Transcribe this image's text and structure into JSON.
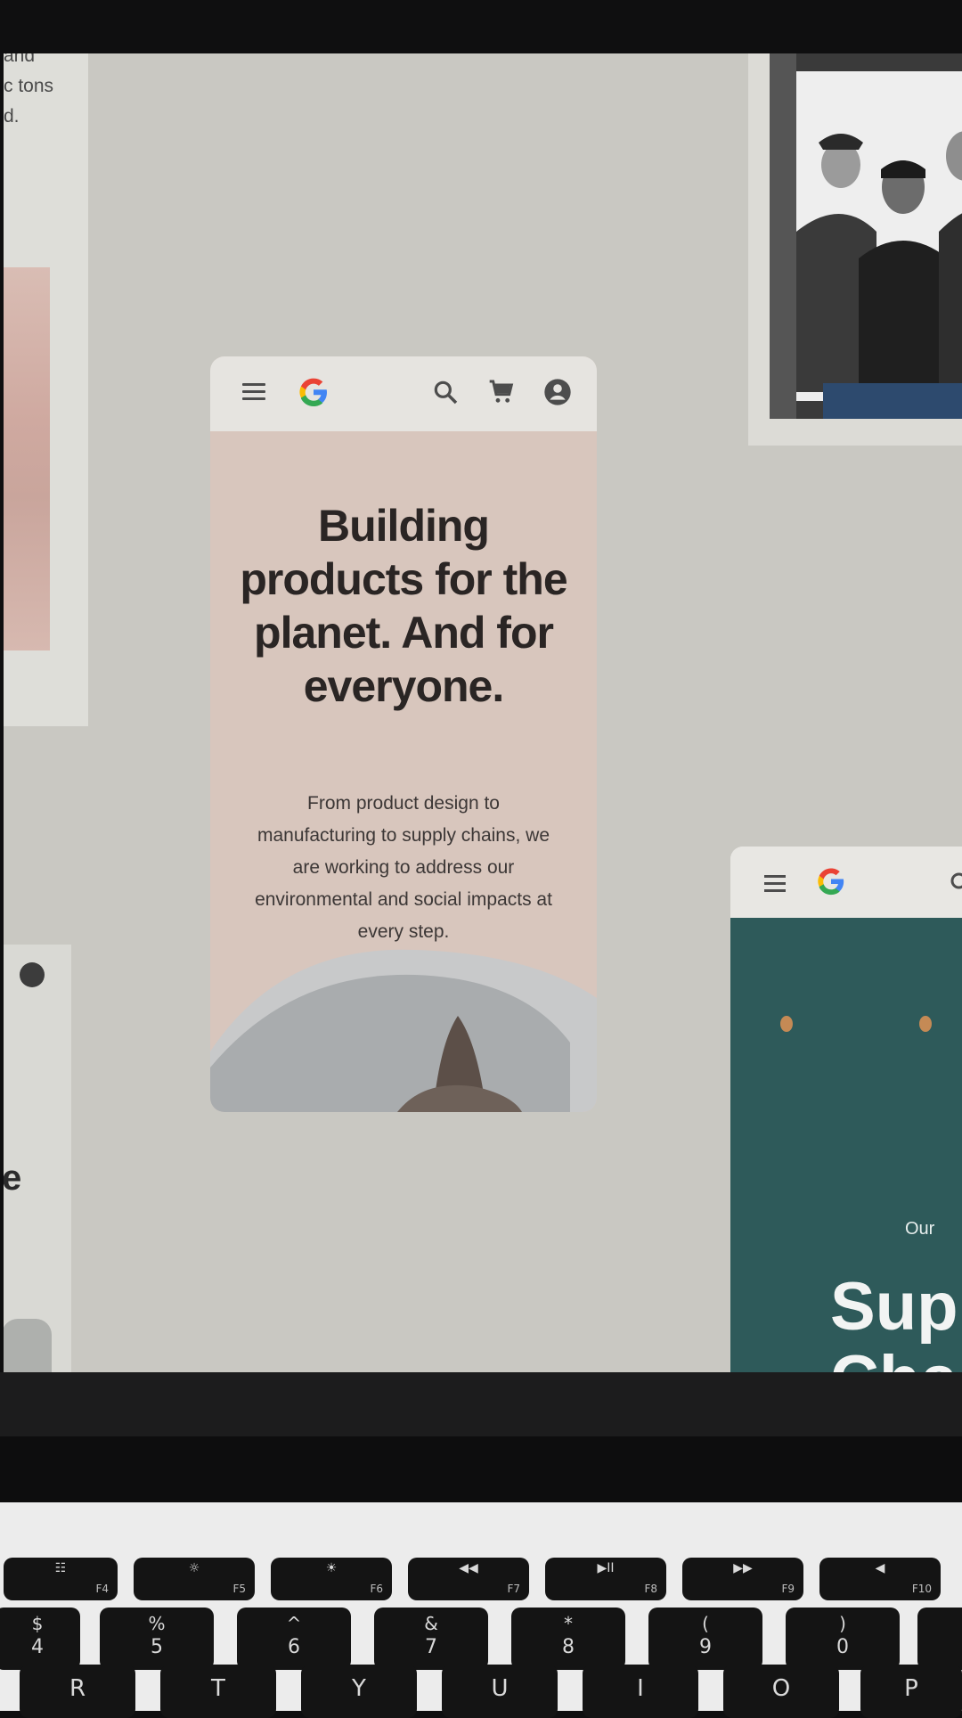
{
  "left_card": {
    "text_lines": [
      "and",
      "c tons",
      "d."
    ],
    "partial_letter": "e"
  },
  "phone_card": {
    "headline": "Building products for the planet. And for everyone.",
    "body": "From product design to manufacturing to supply chains, we are working to address our environmental and social impacts at every step."
  },
  "teal_card": {
    "eyebrow": "Our",
    "title_line1": "Supp",
    "title_line2": "Chai",
    "background": "#2e5a5a"
  },
  "keyboard": {
    "fkeys": [
      {
        "sym": "☷",
        "label": "F4"
      },
      {
        "sym": "☼",
        "label": "F5"
      },
      {
        "sym": "☀",
        "label": "F6"
      },
      {
        "sym": "◀◀",
        "label": "F7"
      },
      {
        "sym": "▶II",
        "label": "F8"
      },
      {
        "sym": "▶▶",
        "label": "F9"
      },
      {
        "sym": "◀",
        "label": "F10"
      }
    ],
    "numkeys": [
      {
        "top": "$",
        "bot": "4"
      },
      {
        "top": "%",
        "bot": "5"
      },
      {
        "top": "^",
        "bot": "6"
      },
      {
        "top": "&",
        "bot": "7"
      },
      {
        "top": "*",
        "bot": "8"
      },
      {
        "top": "(",
        "bot": "9"
      },
      {
        "top": ")",
        "bot": "0"
      }
    ],
    "letterkeys": [
      "R",
      "T",
      "Y",
      "U",
      "I",
      "O",
      "P"
    ]
  },
  "colors": {
    "screen_bg": "#c9c8c2",
    "phone_bg": "#d8c6bd",
    "google_blue": "#4285F4",
    "google_red": "#EA4335",
    "google_yellow": "#FBBC05",
    "google_green": "#34A853"
  }
}
